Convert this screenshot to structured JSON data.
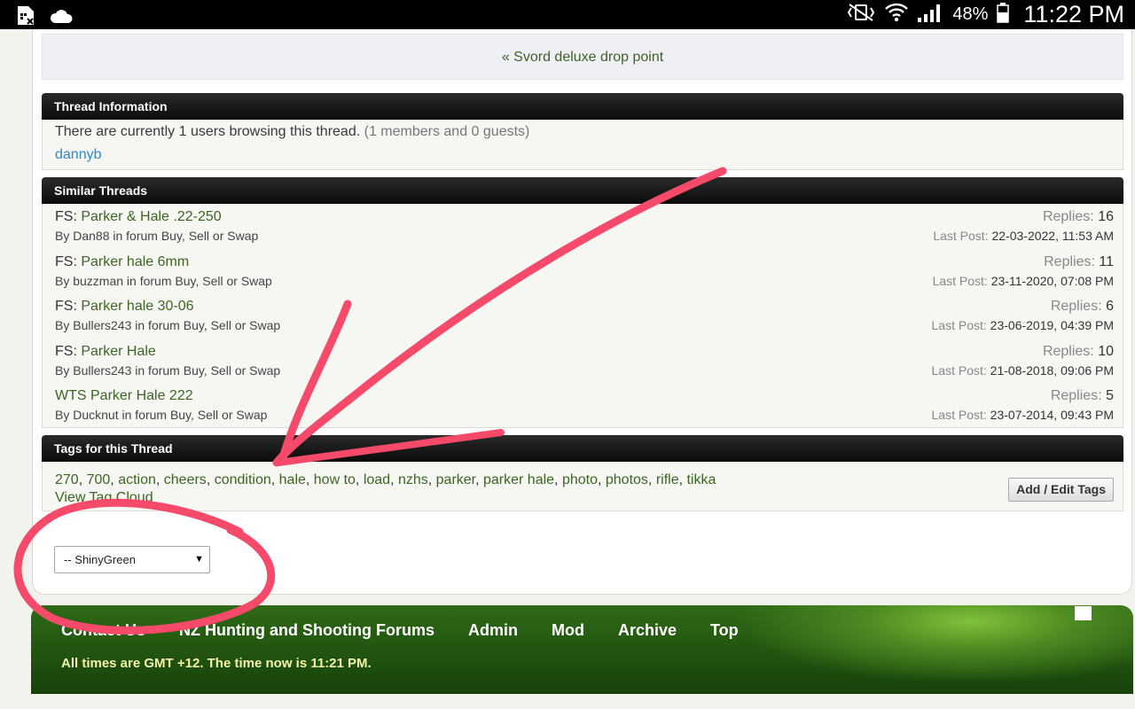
{
  "status_bar": {
    "battery_percent": "48%",
    "time": "11:22 PM",
    "icons": [
      "sim-card-icon",
      "cloud-icon",
      "mute-vibrate-icon",
      "wifi-icon",
      "signal-icon",
      "battery-icon"
    ]
  },
  "prev_thread": {
    "arrow": "«",
    "title": "Svord deluxe drop point"
  },
  "thread_info": {
    "heading": "Thread Information",
    "browsing_text": "There are currently 1 users browsing this thread.",
    "browsing_detail": "(1 members and 0 guests)",
    "user": "dannyb"
  },
  "similar_threads": {
    "heading": "Similar Threads",
    "replies_label": "Replies:",
    "last_post_label": "Last Post:",
    "items": [
      {
        "prefix": "FS:",
        "title": "Parker & Hale .22-250",
        "by": "By Dan88 in forum Buy, Sell or Swap",
        "replies": "16",
        "last_post": "22-03-2022, 11:53 AM"
      },
      {
        "prefix": "FS:",
        "title": "Parker hale 6mm",
        "by": "By buzzman in forum Buy, Sell or Swap",
        "replies": "11",
        "last_post": "23-11-2020, 07:08 PM"
      },
      {
        "prefix": "FS:",
        "title": "Parker hale 30-06",
        "by": "By Bullers243 in forum Buy, Sell or Swap",
        "replies": "6",
        "last_post": "23-06-2019, 04:39 PM"
      },
      {
        "prefix": "FS:",
        "title": "Parker Hale",
        "by": "By Bullers243 in forum Buy, Sell or Swap",
        "replies": "10",
        "last_post": "21-08-2018, 09:06 PM"
      },
      {
        "prefix": "",
        "title": "WTS Parker Hale 222",
        "by": "By Ducknut in forum Buy, Sell or Swap",
        "replies": "5",
        "last_post": "23-07-2014, 09:43 PM"
      }
    ]
  },
  "tags": {
    "heading": "Tags for this Thread",
    "list": [
      "270",
      "700",
      "action",
      "cheers",
      "condition",
      "hale",
      "how to",
      "load",
      "nzhs",
      "parker",
      "parker hale",
      "photo",
      "photos",
      "rifle",
      "tikka"
    ],
    "cloud_link": "View Tag Cloud",
    "edit_button": "Add / Edit Tags"
  },
  "style_chooser": {
    "selected": "-- ShinyGreen"
  },
  "footer": {
    "nav": [
      "Contact Us",
      "NZ Hunting and Shooting Forums",
      "Admin",
      "Mod",
      "Archive",
      "Top"
    ],
    "time_notice": "All times are GMT +12. The time now is 11:21 PM."
  },
  "colors": {
    "annotation": "#f64a6b",
    "link_green": "#3b6622",
    "header_dark": "#1a1a1a",
    "footer_green": "#2f6a17"
  }
}
